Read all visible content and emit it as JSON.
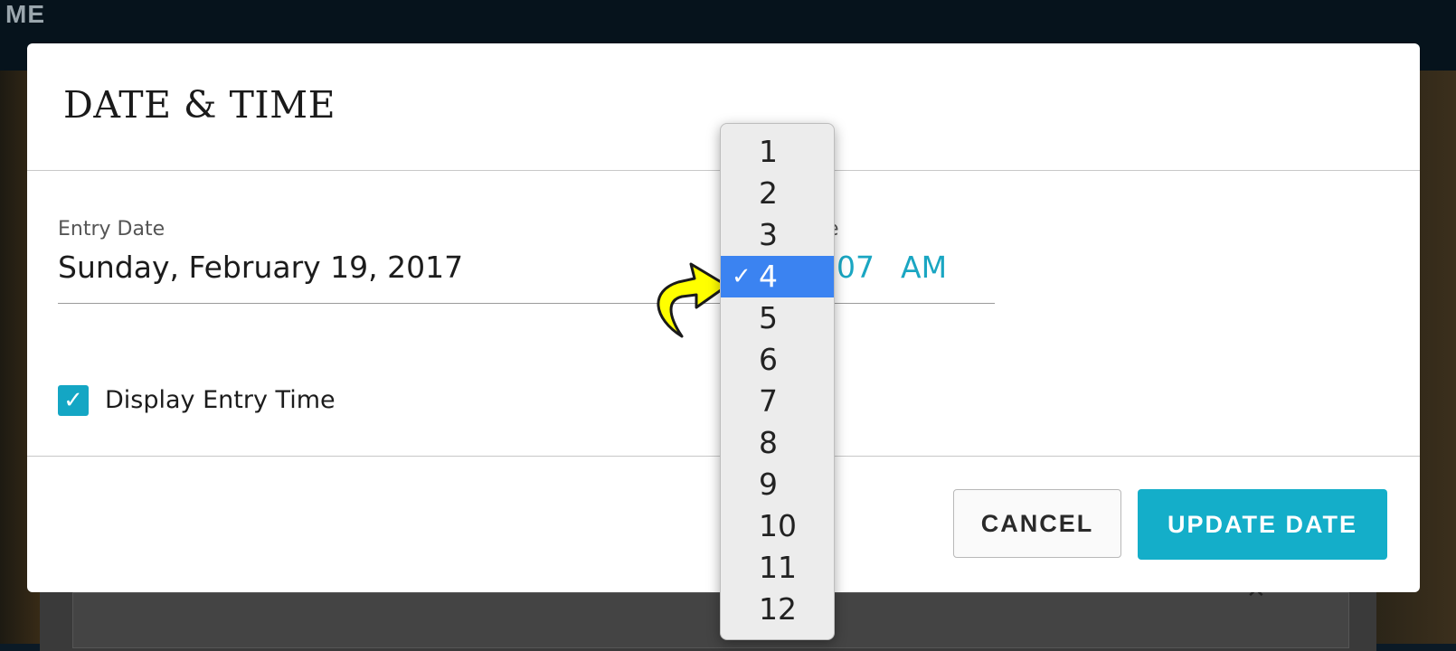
{
  "background": {
    "topbar_text": "ME"
  },
  "modal": {
    "title": "DATE & TIME",
    "entry_date_label": "Entry Date",
    "entry_date_value": "Sunday, February 19, 2017",
    "entry_time_label_partial": "ne",
    "minute_value_partial": "07",
    "ampm_value": "AM",
    "display_time_checkbox": {
      "label": "Display Entry Time",
      "checked": true
    },
    "cancel_label": "CANCEL",
    "update_label": "UPDATE DATE"
  },
  "hour_popup": {
    "items": [
      "1",
      "2",
      "3",
      "4",
      "5",
      "6",
      "7",
      "8",
      "9",
      "10",
      "11",
      "12"
    ],
    "selected": "4",
    "check_glyph": "✓"
  },
  "colors": {
    "accent": "#14aec9",
    "selection": "#3b83f1",
    "annotation_arrow": "#ffff00"
  },
  "icons": {
    "annotation": "curved-arrow-icon",
    "checkbox": "checkmark-icon"
  }
}
